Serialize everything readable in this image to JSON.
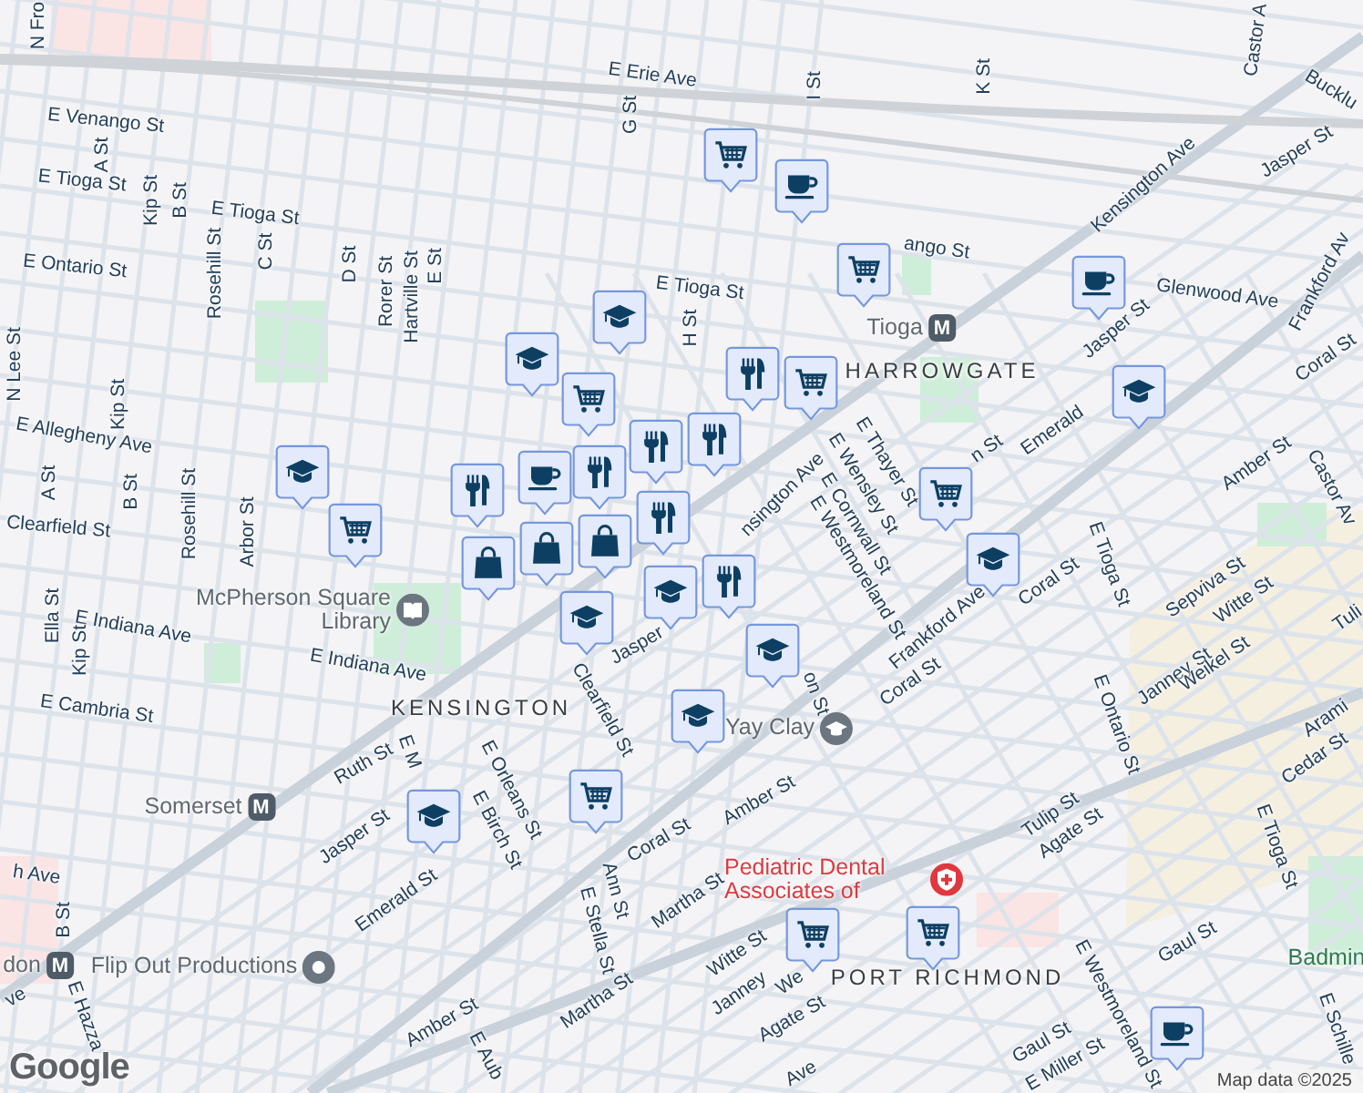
{
  "labels": [
    {
      "text": "N Fro",
      "kind": "street"
    },
    {
      "text": "E Erie Ave",
      "kind": "street"
    },
    {
      "text": "G St",
      "kind": "street"
    },
    {
      "text": "I St",
      "kind": "street"
    },
    {
      "text": "K St",
      "kind": "street"
    },
    {
      "text": "Castor A",
      "kind": "street"
    },
    {
      "text": "Bucklu",
      "kind": "street"
    },
    {
      "text": "E Venango St",
      "kind": "street"
    },
    {
      "text": "A St",
      "kind": "street"
    },
    {
      "text": "E Tioga St",
      "kind": "street"
    },
    {
      "text": "Kip St",
      "kind": "street"
    },
    {
      "text": "B St",
      "kind": "street"
    },
    {
      "text": "E Tioga St",
      "kind": "street"
    },
    {
      "text": "Jasper St",
      "kind": "street"
    },
    {
      "text": "Kensington Ave",
      "kind": "street"
    },
    {
      "text": "ango St",
      "kind": "street"
    },
    {
      "text": "E Ontario St",
      "kind": "street"
    },
    {
      "text": "Rosehill St",
      "kind": "street"
    },
    {
      "text": "C St",
      "kind": "street"
    },
    {
      "text": "D St",
      "kind": "street"
    },
    {
      "text": "Rorer St",
      "kind": "street"
    },
    {
      "text": "Hartville St",
      "kind": "street"
    },
    {
      "text": "E St",
      "kind": "street"
    },
    {
      "text": "E Tioga St",
      "kind": "street"
    },
    {
      "text": "Glenwood Ave",
      "kind": "street"
    },
    {
      "text": "Frankford Av",
      "kind": "street"
    },
    {
      "text": "H St",
      "kind": "street"
    },
    {
      "text": "Tioga",
      "kind": "station",
      "badge": "M"
    },
    {
      "text": "HARROWGATE",
      "kind": "district"
    },
    {
      "text": "Jasper St",
      "kind": "street"
    },
    {
      "text": "Coral St",
      "kind": "street"
    },
    {
      "text": "N Lee St",
      "kind": "street"
    },
    {
      "text": "Kip St",
      "kind": "street"
    },
    {
      "text": "E Allegheny Ave",
      "kind": "street"
    },
    {
      "text": "A St",
      "kind": "street"
    },
    {
      "text": "B St",
      "kind": "street"
    },
    {
      "text": "Rosehill St",
      "kind": "street"
    },
    {
      "text": "Arbor St",
      "kind": "street"
    },
    {
      "text": "Clearfield St",
      "kind": "street"
    },
    {
      "text": "nsington Ave",
      "kind": "street"
    },
    {
      "text": "E Thayer St",
      "kind": "street"
    },
    {
      "text": "E Wensley St",
      "kind": "street"
    },
    {
      "text": "E Cornwall St",
      "kind": "street"
    },
    {
      "text": "E Westmoreland St",
      "kind": "street"
    },
    {
      "text": "n St",
      "kind": "street"
    },
    {
      "text": "Emerald",
      "kind": "street"
    },
    {
      "text": "Amber St",
      "kind": "street"
    },
    {
      "text": "Castor Av",
      "kind": "street"
    },
    {
      "text": "Ella St",
      "kind": "street"
    },
    {
      "text": "E Indiana Ave",
      "kind": "street"
    },
    {
      "text": "Kip St",
      "kind": "street"
    },
    {
      "text": "McPherson Square Library",
      "kind": "library"
    },
    {
      "text": "E Indiana Ave",
      "kind": "street"
    },
    {
      "text": "E Tioga St",
      "kind": "street"
    },
    {
      "text": "Coral St",
      "kind": "street"
    },
    {
      "text": "Frankford Ave",
      "kind": "street"
    },
    {
      "text": "Sepviva St",
      "kind": "street"
    },
    {
      "text": "Witte St",
      "kind": "street"
    },
    {
      "text": "Tuli",
      "kind": "street"
    },
    {
      "text": "Coral St",
      "kind": "street"
    },
    {
      "text": "Jasper",
      "kind": "street"
    },
    {
      "text": "on St",
      "kind": "street"
    },
    {
      "text": "Janney St",
      "kind": "street"
    },
    {
      "text": "Weikel St",
      "kind": "street"
    },
    {
      "text": "KENSINGTON",
      "kind": "district"
    },
    {
      "text": "E Cambria St",
      "kind": "street"
    },
    {
      "text": "Clearfield St",
      "kind": "street"
    },
    {
      "text": "Yay Clay",
      "kind": "school"
    },
    {
      "text": "Arami",
      "kind": "street"
    },
    {
      "text": "Cedar St",
      "kind": "street"
    },
    {
      "text": "E Ontario St",
      "kind": "street"
    },
    {
      "text": "Ruth St",
      "kind": "street"
    },
    {
      "text": "E M",
      "kind": "street"
    },
    {
      "text": "E Orleans St",
      "kind": "street"
    },
    {
      "text": "Amber St",
      "kind": "street"
    },
    {
      "text": "Somerset",
      "kind": "station",
      "badge": "M"
    },
    {
      "text": "E Birch St",
      "kind": "street"
    },
    {
      "text": "Tulip St",
      "kind": "street"
    },
    {
      "text": "Agate St",
      "kind": "street"
    },
    {
      "text": "Jasper St",
      "kind": "street"
    },
    {
      "text": "Coral St",
      "kind": "street"
    },
    {
      "text": "E Tioga St",
      "kind": "street"
    },
    {
      "text": "h Ave",
      "kind": "street"
    },
    {
      "text": "Pediatric Dental Associates of",
      "kind": "medical"
    },
    {
      "text": "Ann St",
      "kind": "street"
    },
    {
      "text": "Emerald St",
      "kind": "street"
    },
    {
      "text": "Martha St",
      "kind": "street"
    },
    {
      "text": "B St",
      "kind": "street"
    },
    {
      "text": "E Stella St",
      "kind": "street"
    },
    {
      "text": "Witte St",
      "kind": "street"
    },
    {
      "text": "Janney",
      "kind": "street"
    },
    {
      "text": "We",
      "kind": "street"
    },
    {
      "text": "Gaul St",
      "kind": "street"
    },
    {
      "text": "Badmin",
      "kind": "park"
    },
    {
      "text": "don",
      "kind": "station",
      "badge": "M"
    },
    {
      "text": "Flip Out Productions",
      "kind": "place"
    },
    {
      "text": "Martha St",
      "kind": "street"
    },
    {
      "text": "PORT RICHMOND",
      "kind": "district"
    },
    {
      "text": "ve",
      "kind": "street"
    },
    {
      "text": "E Westmoreland St",
      "kind": "street"
    },
    {
      "text": "Agate St",
      "kind": "street"
    },
    {
      "text": "E Schille",
      "kind": "street"
    },
    {
      "text": "E Hazza",
      "kind": "street"
    },
    {
      "text": "Gaul St",
      "kind": "street"
    },
    {
      "text": "Amber St",
      "kind": "street"
    },
    {
      "text": "E Miller St",
      "kind": "street"
    },
    {
      "text": "E Aub",
      "kind": "street"
    },
    {
      "text": "Ave",
      "kind": "street"
    }
  ],
  "markers": [
    {
      "kind": "cart"
    },
    {
      "kind": "coffee"
    },
    {
      "kind": "cart"
    },
    {
      "kind": "coffee"
    },
    {
      "kind": "school"
    },
    {
      "kind": "school"
    },
    {
      "kind": "food"
    },
    {
      "kind": "cart"
    },
    {
      "kind": "cart"
    },
    {
      "kind": "school"
    },
    {
      "kind": "food"
    },
    {
      "kind": "food"
    },
    {
      "kind": "food"
    },
    {
      "kind": "coffee"
    },
    {
      "kind": "school"
    },
    {
      "kind": "cart"
    },
    {
      "kind": "cart"
    },
    {
      "kind": "food"
    },
    {
      "kind": "food"
    },
    {
      "kind": "bag"
    },
    {
      "kind": "bag"
    },
    {
      "kind": "school"
    },
    {
      "kind": "food"
    },
    {
      "kind": "bag"
    },
    {
      "kind": "school"
    },
    {
      "kind": "school"
    },
    {
      "kind": "school"
    },
    {
      "kind": "school"
    },
    {
      "kind": "cart"
    },
    {
      "kind": "school"
    },
    {
      "kind": "cart"
    },
    {
      "kind": "cart"
    },
    {
      "kind": "coffee"
    }
  ],
  "logo": "Google",
  "attribution": "Map data ©2025"
}
